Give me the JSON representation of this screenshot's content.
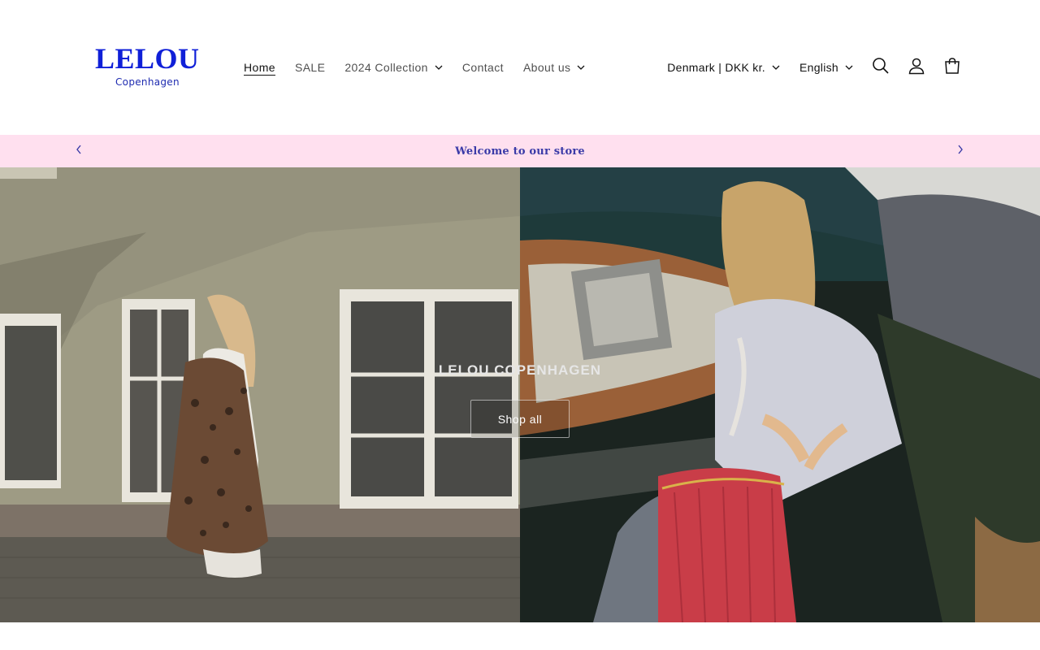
{
  "brand": {
    "name": "LELOU",
    "tagline": "Copenhagen",
    "logo_color": "#1020d8"
  },
  "nav": {
    "items": [
      {
        "label": "Home",
        "active": true,
        "has_dropdown": false
      },
      {
        "label": "SALE",
        "active": false,
        "has_dropdown": false
      },
      {
        "label": "2024 Collection",
        "active": false,
        "has_dropdown": true
      },
      {
        "label": "Contact",
        "active": false,
        "has_dropdown": false
      },
      {
        "label": "About us",
        "active": false,
        "has_dropdown": true
      }
    ]
  },
  "tools": {
    "country": "Denmark | DKK kr.",
    "language": "English",
    "icons": [
      "search-icon",
      "account-icon",
      "cart-icon"
    ]
  },
  "announcement": {
    "text": "Welcome to our store",
    "background": "#ffe0ef",
    "text_color": "#3b3ba8"
  },
  "hero": {
    "heading": "LELOU COPENHAGEN",
    "button_label": "Shop all"
  }
}
